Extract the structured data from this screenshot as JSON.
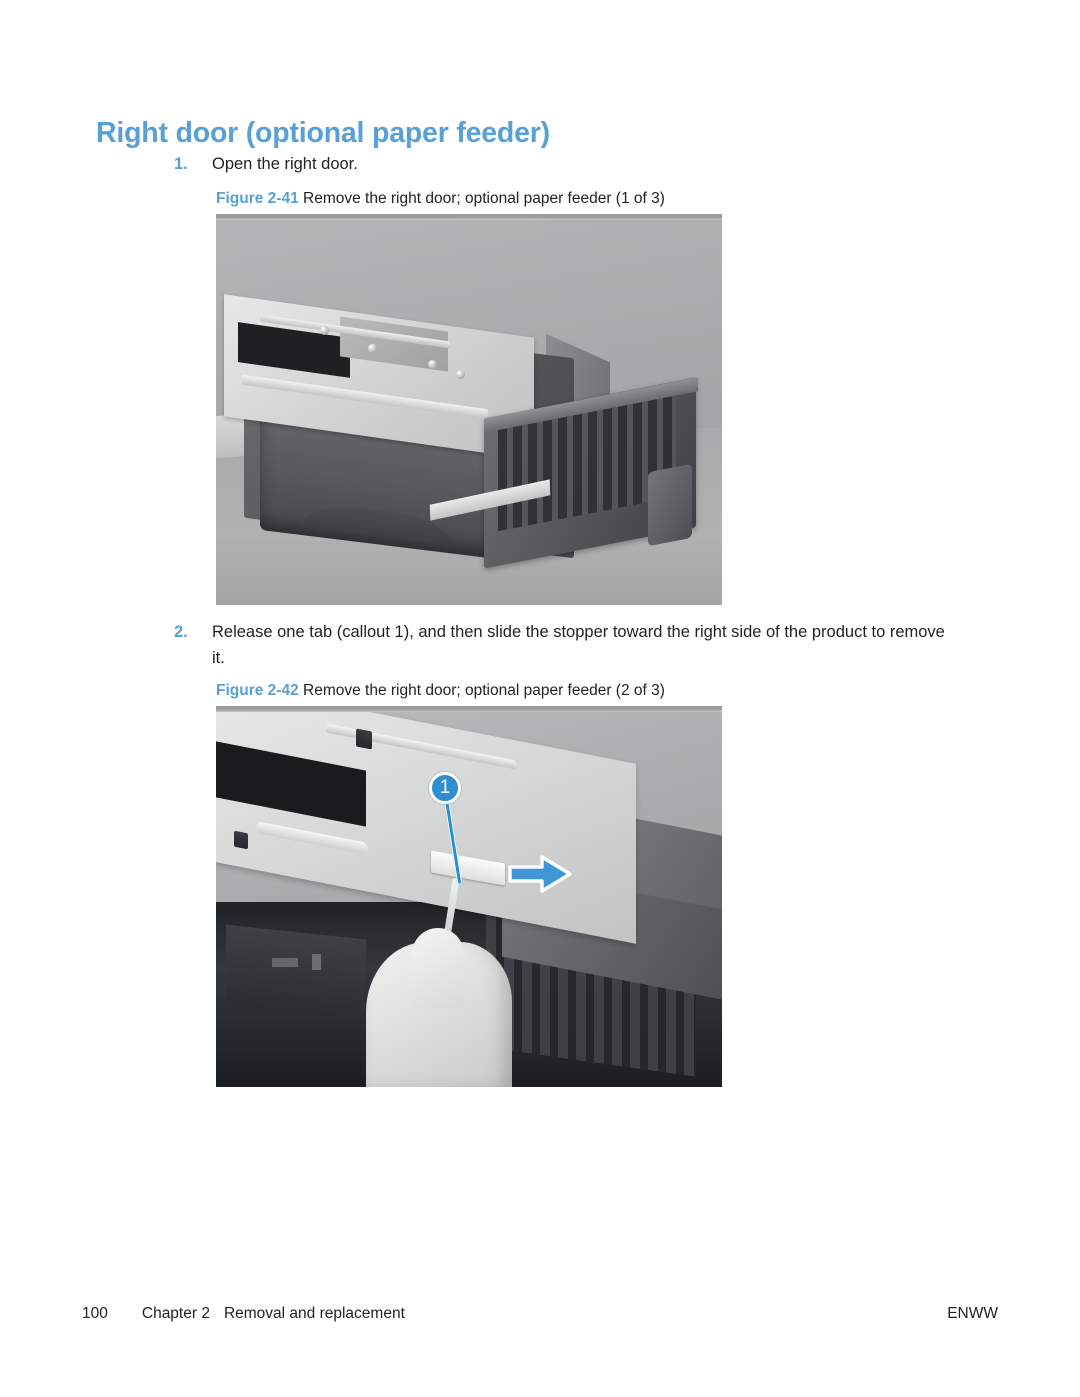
{
  "page": {
    "title": "Right door (optional paper feeder)",
    "title_color": "#57a0d8",
    "background": "#ffffff"
  },
  "steps": [
    {
      "number": "1.",
      "text": "Open the right door."
    },
    {
      "number": "2.",
      "text": "Release one tab (callout 1), and then slide the stopper toward the right side of the product to remove it."
    }
  ],
  "figures": [
    {
      "label": "Figure 2-41",
      "caption": "Remove the right door; optional paper feeder (1 of 3)",
      "alt": "Photo of the optional paper feeder with the right door opened",
      "callouts": []
    },
    {
      "label": "Figure 2-42",
      "caption": "Remove the right door; optional paper feeder (2 of 3)",
      "alt": "Close-up photo of a hand using a tool to release the stopper tab",
      "callouts": [
        {
          "number": "1",
          "color": "#2f8ed0"
        }
      ],
      "arrows": [
        {
          "direction": "right",
          "color": "#3f97d8"
        }
      ]
    }
  ],
  "footer": {
    "page_number": "100",
    "chapter": "Chapter 2",
    "chapter_title": "Removal and replacement",
    "locale": "ENWW"
  }
}
